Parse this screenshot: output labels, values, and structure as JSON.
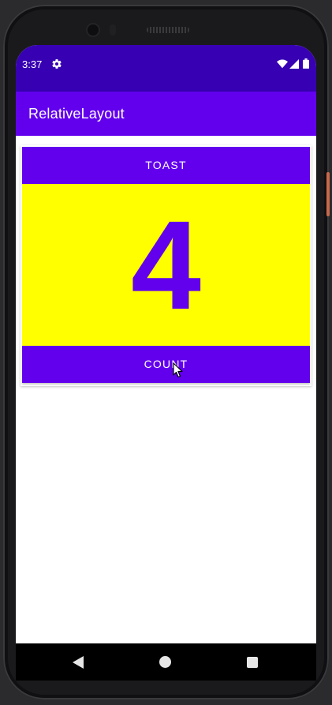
{
  "status_bar": {
    "time": "3:37",
    "settings_icon": "gear-icon",
    "wifi_icon": "wifi-icon",
    "signal_icon": "cell-signal-icon",
    "battery_icon": "battery-icon"
  },
  "app_bar": {
    "title": "RelativeLayout"
  },
  "main": {
    "toast_button_label": "TOAST",
    "count_value": "4",
    "count_button_label": "COUNT"
  },
  "nav_bar": {
    "back_icon": "back-triangle-icon",
    "home_icon": "home-circle-icon",
    "recents_icon": "recents-square-icon"
  },
  "colors": {
    "status_bar": "#3700b3",
    "primary": "#6200ee",
    "count_background": "#ffff00",
    "on_primary": "#ffffff"
  }
}
